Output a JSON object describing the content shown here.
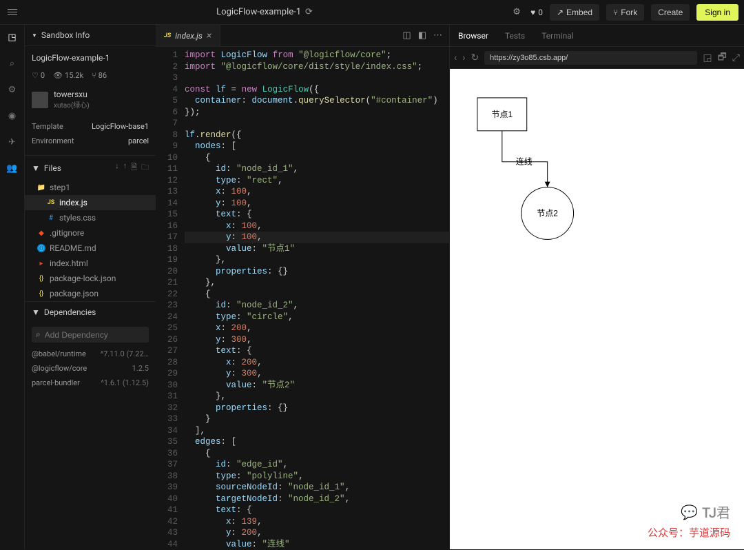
{
  "top": {
    "title": "LogicFlow-example-1",
    "likes": "0",
    "embed": "Embed",
    "fork": "Fork",
    "create": "Create",
    "signin": "Sign in"
  },
  "sidebar": {
    "info_header": "Sandbox Info",
    "project_name": "LogicFlow-example-1",
    "stats": {
      "likes": "0",
      "views": "15.2k",
      "forks": "86"
    },
    "user": {
      "name": "towersxu",
      "sub": "xutao(绿心)"
    },
    "template_k": "Template",
    "template_v": "LogicFlow-base1",
    "env_k": "Environment",
    "env_v": "parcel",
    "files_header": "Files",
    "files": [
      {
        "name": "step1",
        "kind": "folder"
      },
      {
        "name": "index.js",
        "kind": "js",
        "active": true
      },
      {
        "name": "styles.css",
        "kind": "css"
      },
      {
        "name": ".gitignore",
        "kind": "git"
      },
      {
        "name": "README.md",
        "kind": "md"
      },
      {
        "name": "index.html",
        "kind": "html"
      },
      {
        "name": "package-lock.json",
        "kind": "json"
      },
      {
        "name": "package.json",
        "kind": "json"
      }
    ],
    "deps_header": "Dependencies",
    "add_dep": "Add Dependency",
    "deps": [
      {
        "name": "@babel/runtime",
        "ver": "^7.11.0 (7.22…"
      },
      {
        "name": "@logicflow/core",
        "ver": "1.2.5"
      },
      {
        "name": "parcel-bundler",
        "ver": "^1.6.1 (1.12.5)"
      }
    ]
  },
  "editor": {
    "tab_name": "index.js",
    "tab_icon": "JS"
  },
  "code": {
    "lines": [
      [
        [
          "kw",
          "import"
        ],
        [
          "op",
          " "
        ],
        [
          "var",
          "LogicFlow"
        ],
        [
          "op",
          " "
        ],
        [
          "kw",
          "from"
        ],
        [
          "op",
          " "
        ],
        [
          "str",
          "\"@logicflow/core\""
        ],
        [
          "op",
          ";"
        ]
      ],
      [
        [
          "kw",
          "import"
        ],
        [
          "op",
          " "
        ],
        [
          "str",
          "\"@logicflow/core/dist/style/index.css\""
        ],
        [
          "op",
          ";"
        ]
      ],
      [],
      [
        [
          "kw",
          "const"
        ],
        [
          "op",
          " "
        ],
        [
          "var",
          "lf"
        ],
        [
          "op",
          " = "
        ],
        [
          "kw",
          "new"
        ],
        [
          "op",
          " "
        ],
        [
          "cls",
          "LogicFlow"
        ],
        [
          "op",
          "({"
        ]
      ],
      [
        [
          "op",
          "  "
        ],
        [
          "prop",
          "container"
        ],
        [
          "op",
          ": "
        ],
        [
          "var",
          "document"
        ],
        [
          "op",
          "."
        ],
        [
          "fn",
          "querySelector"
        ],
        [
          "op",
          "("
        ],
        [
          "str",
          "\"#container\""
        ],
        [
          "op",
          ")"
        ]
      ],
      [
        [
          "op",
          "});"
        ]
      ],
      [],
      [
        [
          "var",
          "lf"
        ],
        [
          "op",
          "."
        ],
        [
          "fn",
          "render"
        ],
        [
          "op",
          "({"
        ]
      ],
      [
        [
          "op",
          "  "
        ],
        [
          "prop",
          "nodes"
        ],
        [
          "op",
          ": ["
        ]
      ],
      [
        [
          "op",
          "    {"
        ]
      ],
      [
        [
          "op",
          "      "
        ],
        [
          "prop",
          "id"
        ],
        [
          "op",
          ": "
        ],
        [
          "str",
          "\"node_id_1\""
        ],
        [
          "op",
          ","
        ]
      ],
      [
        [
          "op",
          "      "
        ],
        [
          "prop",
          "type"
        ],
        [
          "op",
          ": "
        ],
        [
          "str",
          "\"rect\""
        ],
        [
          "op",
          ","
        ]
      ],
      [
        [
          "op",
          "      "
        ],
        [
          "prop",
          "x"
        ],
        [
          "op",
          ": "
        ],
        [
          "num",
          "100"
        ],
        [
          "op",
          ","
        ]
      ],
      [
        [
          "op",
          "      "
        ],
        [
          "prop",
          "y"
        ],
        [
          "op",
          ": "
        ],
        [
          "num",
          "100"
        ],
        [
          "op",
          ","
        ]
      ],
      [
        [
          "op",
          "      "
        ],
        [
          "prop",
          "text"
        ],
        [
          "op",
          ": {"
        ]
      ],
      [
        [
          "op",
          "        "
        ],
        [
          "prop",
          "x"
        ],
        [
          "op",
          ": "
        ],
        [
          "num",
          "100"
        ],
        [
          "op",
          ","
        ]
      ],
      [
        [
          "op",
          "        "
        ],
        [
          "prop",
          "y"
        ],
        [
          "op",
          ": "
        ],
        [
          "num",
          "100"
        ],
        [
          "op",
          ","
        ]
      ],
      [
        [
          "op",
          "        "
        ],
        [
          "prop",
          "value"
        ],
        [
          "op",
          ": "
        ],
        [
          "str",
          "\"节点1\""
        ]
      ],
      [
        [
          "op",
          "      },"
        ]
      ],
      [
        [
          "op",
          "      "
        ],
        [
          "prop",
          "properties"
        ],
        [
          "op",
          ": {}"
        ]
      ],
      [
        [
          "op",
          "    },"
        ]
      ],
      [
        [
          "op",
          "    {"
        ]
      ],
      [
        [
          "op",
          "      "
        ],
        [
          "prop",
          "id"
        ],
        [
          "op",
          ": "
        ],
        [
          "str",
          "\"node_id_2\""
        ],
        [
          "op",
          ","
        ]
      ],
      [
        [
          "op",
          "      "
        ],
        [
          "prop",
          "type"
        ],
        [
          "op",
          ": "
        ],
        [
          "str",
          "\"circle\""
        ],
        [
          "op",
          ","
        ]
      ],
      [
        [
          "op",
          "      "
        ],
        [
          "prop",
          "x"
        ],
        [
          "op",
          ": "
        ],
        [
          "num",
          "200"
        ],
        [
          "op",
          ","
        ]
      ],
      [
        [
          "op",
          "      "
        ],
        [
          "prop",
          "y"
        ],
        [
          "op",
          ": "
        ],
        [
          "num",
          "300"
        ],
        [
          "op",
          ","
        ]
      ],
      [
        [
          "op",
          "      "
        ],
        [
          "prop",
          "text"
        ],
        [
          "op",
          ": {"
        ]
      ],
      [
        [
          "op",
          "        "
        ],
        [
          "prop",
          "x"
        ],
        [
          "op",
          ": "
        ],
        [
          "num",
          "200"
        ],
        [
          "op",
          ","
        ]
      ],
      [
        [
          "op",
          "        "
        ],
        [
          "prop",
          "y"
        ],
        [
          "op",
          ": "
        ],
        [
          "num",
          "300"
        ],
        [
          "op",
          ","
        ]
      ],
      [
        [
          "op",
          "        "
        ],
        [
          "prop",
          "value"
        ],
        [
          "op",
          ": "
        ],
        [
          "str",
          "\"节点2\""
        ]
      ],
      [
        [
          "op",
          "      },"
        ]
      ],
      [
        [
          "op",
          "      "
        ],
        [
          "prop",
          "properties"
        ],
        [
          "op",
          ": {}"
        ]
      ],
      [
        [
          "op",
          "    }"
        ]
      ],
      [
        [
          "op",
          "  ],"
        ]
      ],
      [
        [
          "op",
          "  "
        ],
        [
          "prop",
          "edges"
        ],
        [
          "op",
          ": ["
        ]
      ],
      [
        [
          "op",
          "    {"
        ]
      ],
      [
        [
          "op",
          "      "
        ],
        [
          "prop",
          "id"
        ],
        [
          "op",
          ": "
        ],
        [
          "str",
          "\"edge_id\""
        ],
        [
          "op",
          ","
        ]
      ],
      [
        [
          "op",
          "      "
        ],
        [
          "prop",
          "type"
        ],
        [
          "op",
          ": "
        ],
        [
          "str",
          "\"polyline\""
        ],
        [
          "op",
          ","
        ]
      ],
      [
        [
          "op",
          "      "
        ],
        [
          "prop",
          "sourceNodeId"
        ],
        [
          "op",
          ": "
        ],
        [
          "str",
          "\"node_id_1\""
        ],
        [
          "op",
          ","
        ]
      ],
      [
        [
          "op",
          "      "
        ],
        [
          "prop",
          "targetNodeId"
        ],
        [
          "op",
          ": "
        ],
        [
          "str",
          "\"node_id_2\""
        ],
        [
          "op",
          ","
        ]
      ],
      [
        [
          "op",
          "      "
        ],
        [
          "prop",
          "text"
        ],
        [
          "op",
          ": {"
        ]
      ],
      [
        [
          "op",
          "        "
        ],
        [
          "prop",
          "x"
        ],
        [
          "op",
          ": "
        ],
        [
          "num",
          "139"
        ],
        [
          "op",
          ","
        ]
      ],
      [
        [
          "op",
          "        "
        ],
        [
          "prop",
          "y"
        ],
        [
          "op",
          ": "
        ],
        [
          "num",
          "200"
        ],
        [
          "op",
          ","
        ]
      ],
      [
        [
          "op",
          "        "
        ],
        [
          "prop",
          "value"
        ],
        [
          "op",
          ": "
        ],
        [
          "str",
          "\"连线\""
        ]
      ]
    ],
    "highlight_line": 17
  },
  "preview": {
    "tabs": {
      "browser": "Browser",
      "tests": "Tests",
      "terminal": "Terminal"
    },
    "url": "https://zy3o85.csb.app/"
  },
  "diagram": {
    "node1": "节点1",
    "node2": "节点2",
    "edge": "连线"
  },
  "watermark": {
    "chat": "TJ君",
    "sub": "公众号：芋道源码"
  }
}
